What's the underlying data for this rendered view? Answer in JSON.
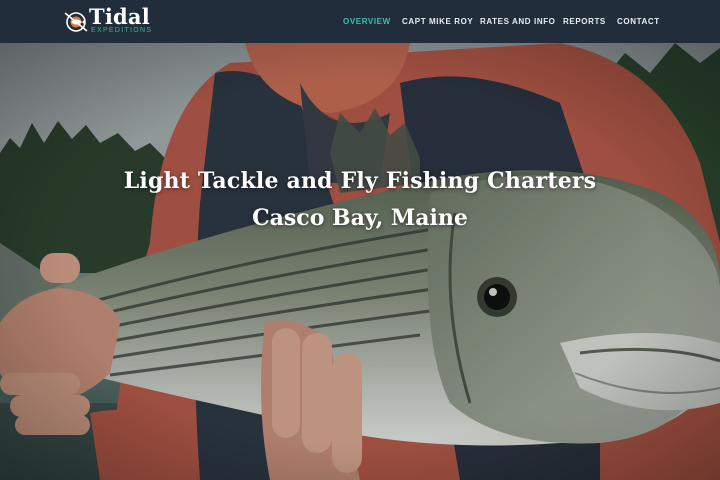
{
  "brand": {
    "name": "Tidal",
    "sub": "EXPEDITIONS"
  },
  "nav": {
    "items": [
      {
        "label": "OVERVIEW",
        "active": true
      },
      {
        "label": "CAPT MIKE ROY",
        "active": false
      },
      {
        "label": "RATES AND INFO",
        "active": false
      },
      {
        "label": "REPORTS",
        "active": false
      },
      {
        "label": "CONTACT",
        "active": false
      }
    ]
  },
  "hero": {
    "headline": "Light Tackle and Fly Fishing Charters",
    "subhead": "Casco Bay, Maine"
  },
  "colors": {
    "navbar": "#222d3b",
    "accent": "#3bbfb2",
    "text": "#ffffff"
  },
  "icons": {
    "logo": "fish-compass-icon"
  }
}
